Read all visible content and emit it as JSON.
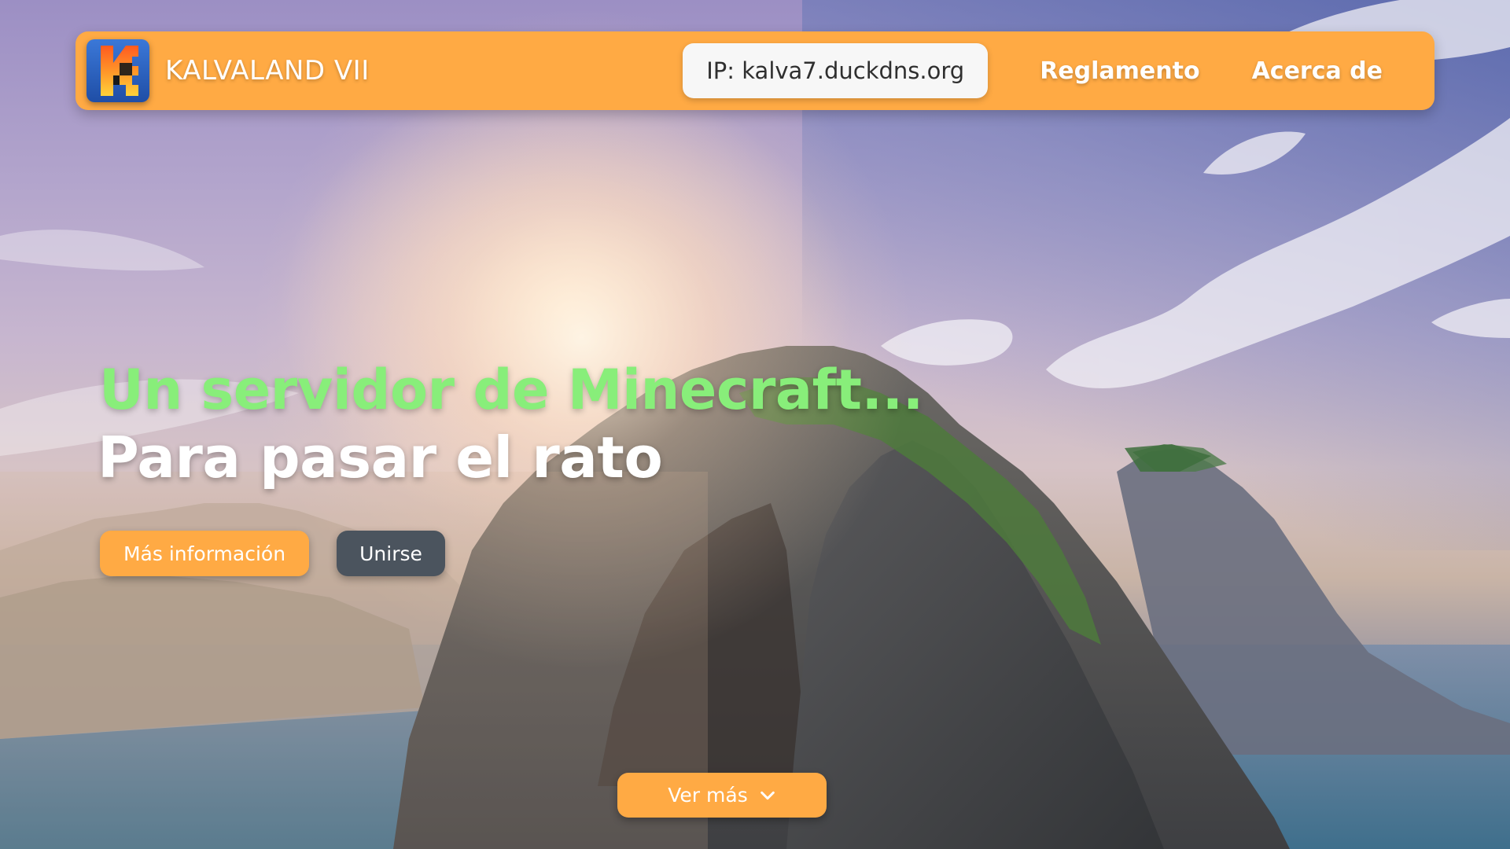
{
  "navbar": {
    "brand": "KALVALAND VII",
    "logo_icon": "kalvaland-k-logo-icon",
    "ip_label": "IP: kalva7.duckdns.org",
    "links": [
      {
        "label": "Reglamento"
      },
      {
        "label": "Acerca de"
      }
    ]
  },
  "hero": {
    "headline": "Un servidor de Minecraft...",
    "subheadline": "Para pasar el rato",
    "primary_button": "Más información",
    "secondary_button": "Unirse"
  },
  "scroll_button": {
    "label": "Ver más",
    "icon": "chevron-down-icon"
  },
  "colors": {
    "accent": "#ffaa44",
    "headline": "#88ee7a",
    "secondary_button": "#4b545e",
    "ip_pill": "#f7f7f7"
  }
}
